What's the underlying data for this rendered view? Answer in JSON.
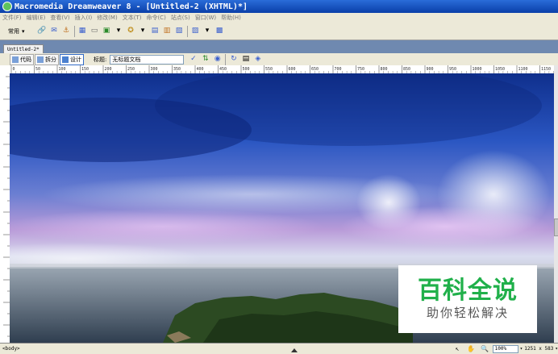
{
  "window": {
    "title": "Macromedia Dreamweaver 8 - [Untitled-2 (XHTML)*]"
  },
  "menu": [
    "文件(F)",
    "编辑(E)",
    "查看(V)",
    "插入(I)",
    "修改(M)",
    "文本(T)",
    "命令(C)",
    "站点(S)",
    "窗口(W)",
    "帮助(H)"
  ],
  "insert_bar": {
    "category": "常用"
  },
  "document": {
    "tab": "Untitled-2*"
  },
  "doc_toolbar": {
    "code_label": "代码",
    "split_label": "拆分",
    "design_label": "设计",
    "title_label": "标题:",
    "title_value": "无标题文档"
  },
  "ruler": {
    "labels": [
      "0",
      "50",
      "100",
      "150",
      "200",
      "250",
      "300",
      "350",
      "400",
      "450",
      "500",
      "550",
      "600",
      "650",
      "700",
      "750",
      "800",
      "850",
      "900",
      "950",
      "1000",
      "1050",
      "1100",
      "1150"
    ]
  },
  "status": {
    "tag_selector": "<body>",
    "zoom": "100%",
    "dimensions": "1251 x 583"
  },
  "watermark": {
    "main": "百科全说",
    "sub": "助你轻松解决"
  }
}
